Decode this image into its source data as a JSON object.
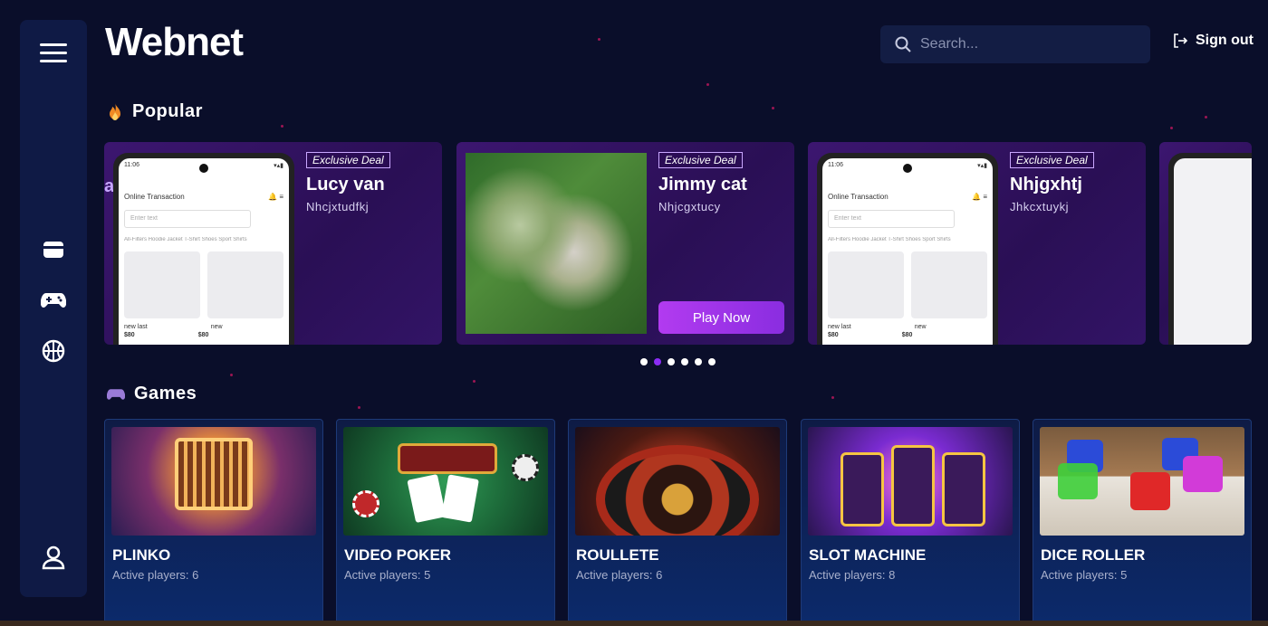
{
  "header": {
    "logo": "Webnet",
    "search_placeholder": "Search...",
    "signout_label": "Sign out"
  },
  "sidebar": {
    "items": [
      {
        "name": "menu-icon"
      },
      {
        "name": "wallet-icon"
      },
      {
        "name": "gamepad-icon"
      },
      {
        "name": "basketball-icon"
      },
      {
        "name": "user-icon"
      }
    ]
  },
  "popular": {
    "title": "Popular",
    "peek_label": "ab",
    "deals": [
      {
        "badge": "Exclusive Deal",
        "name": "Lucy van",
        "sub": "Nhcjxtudfkj"
      },
      {
        "badge": "Exclusive Deal",
        "name": "Jimmy cat",
        "sub": "Nhjcgxtucy",
        "button": "Play Now"
      },
      {
        "badge": "Exclusive Deal",
        "name": "Nhjgxhtj",
        "sub": "Jhkcxtuykj"
      }
    ],
    "phone_mock": {
      "time": "11:06",
      "title": "Online Transaction",
      "input_placeholder": "Enter text",
      "filters": "All-Filters  Hoodie  Jacket  T-Shirt  Shoes  Sport  Shirts",
      "item1": "new last",
      "item2": "new",
      "price1": "$80",
      "price2": "$80"
    },
    "carousel_pages": 6,
    "active_page": 2
  },
  "games": {
    "title": "Games",
    "players_prefix": "Active players: ",
    "items": [
      {
        "name": "PLINKO",
        "players": "Active players: 6"
      },
      {
        "name": "VIDEO POKER",
        "players": "Active players: 5"
      },
      {
        "name": "ROULLETE",
        "players": "Active players: 6"
      },
      {
        "name": "SLOT MACHINE",
        "players": "Active players: 8"
      },
      {
        "name": "DICE ROLLER",
        "players": "Active players: 5"
      }
    ]
  },
  "colors": {
    "background": "#0a0e2a",
    "sidebar": "#0f1a45",
    "accent": "#8b2cf5",
    "play_button": "#b23bf0"
  }
}
